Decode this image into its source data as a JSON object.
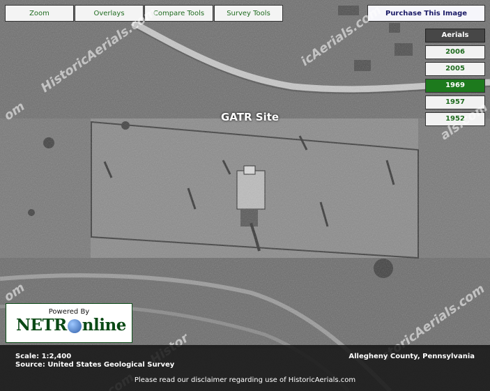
{
  "toolbar": {
    "zoom": "Zoom",
    "overlays": "Overlays",
    "compare": "Compare Tools",
    "survey": "Survey Tools",
    "purchase": "Purchase This Image"
  },
  "aerials": {
    "header": "Aerials",
    "years": [
      "2006",
      "2005",
      "1969",
      "1957",
      "1952"
    ],
    "selected": "1969"
  },
  "map": {
    "site_label": "GATR  Site",
    "watermarks": [
      "HistoricAerials.com",
      "icAerials.com",
      "als.com",
      "storicAerials.com",
      "Histor",
      "om",
      "om",
      "com"
    ]
  },
  "logo": {
    "powered_by": "Powered By",
    "brand_a": "NETR",
    "brand_b": "nline"
  },
  "footer": {
    "scale": "Scale: 1:2,400",
    "source": "Source: United States Geological Survey",
    "location": "Allegheny County, Pennsylvania",
    "disclaimer": "Please read our disclaimer regarding use of HistoricAerials.com"
  },
  "colors": {
    "accent_green": "#1d7a1d",
    "button_text": "#1f6b1f",
    "purchase_text": "#1a1a66"
  }
}
